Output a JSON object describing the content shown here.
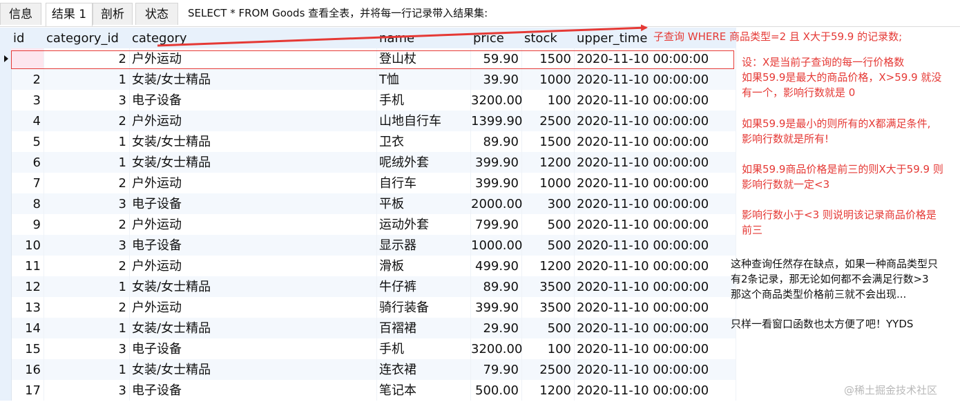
{
  "tabs": [
    {
      "label": "信息",
      "active": false
    },
    {
      "label": "结果 1",
      "active": true
    },
    {
      "label": "剖析",
      "active": false
    },
    {
      "label": "状态",
      "active": false
    }
  ],
  "query_text": "SELECT * FROM Goods 查看全表，并将每一行记录带入结果集:",
  "columns": [
    "id",
    "category_id",
    "category",
    "name",
    "price",
    "stock",
    "upper_time"
  ],
  "rows": [
    [
      "",
      "2",
      "户外运动",
      "登山杖",
      "59.90",
      "1500",
      "2020-11-10 00:00:00"
    ],
    [
      "2",
      "1",
      "女装/女士精品",
      "T恤",
      "39.90",
      "1000",
      "2020-11-10 00:00:00"
    ],
    [
      "3",
      "3",
      "电子设备",
      "手机",
      "3200.00",
      "100",
      "2020-11-10 00:00:00"
    ],
    [
      "4",
      "2",
      "户外运动",
      "山地自行车",
      "1399.90",
      "2500",
      "2020-11-10 00:00:00"
    ],
    [
      "5",
      "1",
      "女装/女士精品",
      "卫衣",
      "89.90",
      "1500",
      "2020-11-10 00:00:00"
    ],
    [
      "6",
      "1",
      "女装/女士精品",
      "呢绒外套",
      "399.90",
      "1200",
      "2020-11-10 00:00:00"
    ],
    [
      "7",
      "2",
      "户外运动",
      "自行车",
      "399.90",
      "1000",
      "2020-11-10 00:00:00"
    ],
    [
      "8",
      "3",
      "电子设备",
      "平板",
      "2000.00",
      "300",
      "2020-11-10 00:00:00"
    ],
    [
      "9",
      "2",
      "户外运动",
      "运动外套",
      "799.90",
      "500",
      "2020-11-10 00:00:00"
    ],
    [
      "10",
      "3",
      "电子设备",
      "显示器",
      "1000.00",
      "500",
      "2020-11-10 00:00:00"
    ],
    [
      "11",
      "2",
      "户外运动",
      "滑板",
      "499.90",
      "1200",
      "2020-11-10 00:00:00"
    ],
    [
      "12",
      "1",
      "女装/女士精品",
      "牛仔裤",
      "89.90",
      "3500",
      "2020-11-10 00:00:00"
    ],
    [
      "13",
      "2",
      "户外运动",
      "骑行装备",
      "399.90",
      "3500",
      "2020-11-10 00:00:00"
    ],
    [
      "14",
      "1",
      "女装/女士精品",
      "百褶裙",
      "29.90",
      "500",
      "2020-11-10 00:00:00"
    ],
    [
      "15",
      "3",
      "电子设备",
      "手机",
      "3200.00",
      "100",
      "2020-11-10 00:00:00"
    ],
    [
      "16",
      "1",
      "女装/女士精品",
      "连衣裙",
      "79.90",
      "2500",
      "2020-11-10 00:00:00"
    ],
    [
      "17",
      "3",
      "电子设备",
      "笔记本",
      "500.00",
      "1200",
      "2020-11-10 00:00:00"
    ]
  ],
  "annotations": {
    "subquery": "子查询 WHERE 商品类型=2 且 X大于59.9 的记录数;",
    "note1": [
      "设：X是当前子查询的每一行价格数",
      "如果59.9是最大的商品价格，X>59.9 就没",
      "有一个，影响行数就是 0"
    ],
    "note2": [
      "如果59.9是最小的则所有的X都满足条件,",
      "影响行数就是所有!"
    ],
    "note3": [
      "如果59.9商品价格是前三的则X大于59.9 则",
      "影响行数就一定<3"
    ],
    "note4": [
      "影响行数小于<3 则说明该记录商品价格是",
      "前三"
    ],
    "note5": [
      "这种查询任然存在缺点，如果一种商品类型只",
      "有2条记录，那无论如何都不会满足行数>3",
      "那这个商品类型价格前三就不会出现..."
    ],
    "note6": "只样一看窗口函数也太方便了吧！YYDS"
  },
  "watermark": "@稀土掘金技术社区",
  "colors": {
    "annotation_red": "#e53935",
    "header_bg": "#e8f1fb",
    "alt_row_bg": "#f4f8fd"
  }
}
